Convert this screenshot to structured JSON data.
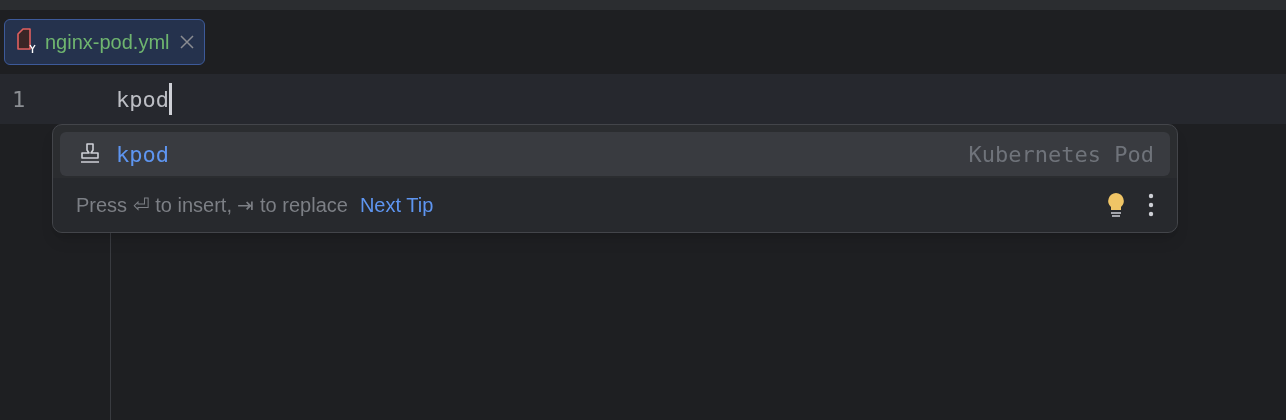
{
  "tabs": [
    {
      "label": "nginx-pod.yml",
      "selected": true
    }
  ],
  "editor": {
    "lines": [
      {
        "number": "1",
        "text": "kpod",
        "current": true
      }
    ]
  },
  "completion": {
    "items": [
      {
        "label": "kpod",
        "type_text": "Kubernetes Pod",
        "selected": true
      }
    ],
    "hint": "Press ⏎ to insert, ⇥ to replace",
    "next_tip": "Next Tip"
  }
}
